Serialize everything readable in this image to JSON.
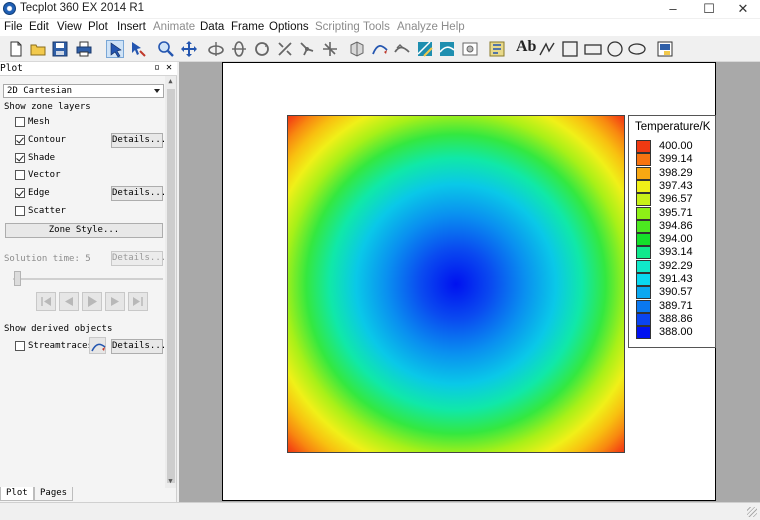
{
  "window": {
    "title": "Tecplot 360 EX 2014 R1",
    "minimize": "–",
    "maximize": "☐",
    "close": "✕"
  },
  "menu": [
    "File",
    "Edit",
    "View",
    "Plot",
    "Insert",
    "Animate",
    "Data",
    "Frame",
    "Options",
    "Scripting",
    "Tools",
    "Analyze",
    "Help"
  ],
  "toolbar": {
    "icons": [
      "new-file-icon",
      "open-folder-icon",
      "save-icon",
      "print-icon",
      "select-pointer-icon",
      "adjustor-icon",
      "zoom-icon",
      "translate-icon",
      "rotate-x-icon",
      "rotate-y-icon",
      "rotate-z-icon",
      "rotate-a-icon",
      "probe-icon",
      "slice-icon",
      "extract-icon",
      "streamtrace-icon",
      "contour-line-icon",
      "contour-add-icon",
      "contour-fill-icon",
      "image-icon",
      "macro-icon",
      "text-icon",
      "polyline-icon",
      "square-icon",
      "rectangle-icon",
      "circle-icon",
      "ellipse-icon",
      "frame-settings-icon"
    ],
    "text_tool_label": "Ab"
  },
  "panel": {
    "title": "Plot",
    "pin": "▫",
    "close": "✕",
    "plot_type": "2D Cartesian",
    "show_zone_layers": "Show zone layers",
    "layers": [
      {
        "label": "Mesh",
        "checked": false,
        "details": ""
      },
      {
        "label": "Contour",
        "checked": true,
        "details": "Details..."
      },
      {
        "label": "Shade",
        "checked": true,
        "details": ""
      },
      {
        "label": "Vector",
        "checked": false,
        "details": ""
      },
      {
        "label": "Edge",
        "checked": true,
        "details": "Details..."
      },
      {
        "label": "Scatter",
        "checked": false,
        "details": ""
      }
    ],
    "zone_style": "Zone Style...",
    "solution_time_label": "Solution time: 5",
    "solution_details": "Details...",
    "show_derived": "Show derived objects",
    "streamtraces_label": "Streamtraces",
    "streamtraces_checked": false,
    "streamtraces_details": "Details...",
    "tabs": [
      "Plot",
      "Pages"
    ]
  },
  "legend": {
    "title": "Temperature/K",
    "levels": [
      {
        "value": "400.00",
        "color": "#f03a12"
      },
      {
        "value": "399.14",
        "color": "#f87410"
      },
      {
        "value": "398.29",
        "color": "#f8a812"
      },
      {
        "value": "397.43",
        "color": "#f0f018"
      },
      {
        "value": "396.57",
        "color": "#c8f018"
      },
      {
        "value": "395.71",
        "color": "#8ef016"
      },
      {
        "value": "394.86",
        "color": "#4ce820"
      },
      {
        "value": "394.00",
        "color": "#14e02a"
      },
      {
        "value": "393.14",
        "color": "#10e88c"
      },
      {
        "value": "392.29",
        "color": "#10e8c8"
      },
      {
        "value": "391.43",
        "color": "#0ad8f0"
      },
      {
        "value": "390.57",
        "color": "#0aa8f0"
      },
      {
        "value": "389.71",
        "color": "#0a78f0"
      },
      {
        "value": "388.86",
        "color": "#0a44f0"
      },
      {
        "value": "388.00",
        "color": "#0011f0"
      }
    ]
  }
}
